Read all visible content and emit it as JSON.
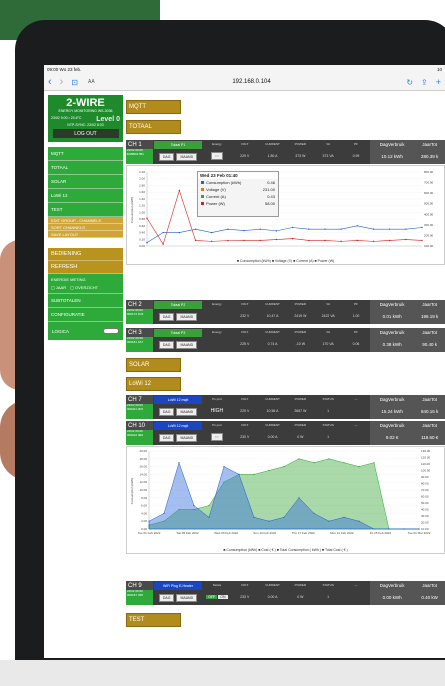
{
  "status": {
    "time": "09:00",
    "date": "Wo 23 feb.",
    "battery": "10"
  },
  "browser": {
    "text_size": "AA",
    "url": "192.168.0.104"
  },
  "brand": {
    "title": "2-WIRE",
    "subtitle": "ENERGY MONITORING WS-3036",
    "datetime": "23/02 9:00 • 23.6°C",
    "level": "Level 0",
    "ntp": "NTP-SYNC: 23/02 8:03",
    "logout": "LOG OUT"
  },
  "menu": {
    "items": [
      "MQTT",
      "TOTAAL",
      "SOLAR",
      "LoWi 12",
      "TEST"
    ],
    "edit_items": [
      "EDIT GROUP - CHANNELS",
      "SORT CHANNELS",
      "SAVE LAYOUT"
    ],
    "bediening": "BEDIENING",
    "refresh": "REFRESH",
    "energie_title": "ENERGIE METING",
    "jaar": "JAAR",
    "overzicht": "OVERZICHT",
    "subtotalen": "SUBTOTALEN",
    "configuratie": "CONFIGURATIE",
    "logica": "LOGICA"
  },
  "tiles": {
    "mqtt": "MQTT",
    "totaal": "TOTAAL",
    "solar": "SOLAR",
    "lowi": "LoWi 12",
    "test": "TEST"
  },
  "columns": {
    "energy": "Energy",
    "pi_port": "P1 port",
    "relais": "Relais",
    "volt": "VOLT",
    "current": "CURRENT",
    "power": "POWER",
    "va": "VA",
    "pf": "PF",
    "status": "STATUS",
    "dash": "---",
    "dag": "DagVerbruik",
    "jaar": "JaarTot"
  },
  "buttons": {
    "dag": "DAG",
    "maand": "MAAND"
  },
  "ch1": {
    "name": "CH 1",
    "time": "23/02 09:00 ESBB017B4",
    "title": "Totaal P1",
    "vals": [
      "229 V",
      "1.80 A",
      "373 W",
      "373 VA",
      "0.99"
    ],
    "dag": "10.12 kWh",
    "jaar": "280.39 k"
  },
  "ch2": {
    "name": "CH 2",
    "time": "23/02 09:00 000172 1D3",
    "title": "Totaal P2",
    "vals": [
      "232 V",
      "10.47 A",
      "2419 W",
      "2422 VA",
      "1.00"
    ],
    "dag": "0.01 kWh",
    "jaar": "198.19 k"
  },
  "ch3": {
    "name": "CH 3",
    "time": "23/02 09:00 000181 FA7",
    "title": "Totaal P3",
    "vals": [
      "225 V",
      "0.74 A",
      "-10 W",
      "170 VA",
      "0.06"
    ],
    "dag": "0.38 kWh",
    "jaar": "90.40 k"
  },
  "ch7": {
    "name": "CH 7",
    "time": "23/02 09:00 000201 3F6",
    "title": "LoWi 12 mqtt",
    "pi": "HIGH",
    "vals": [
      "229 V",
      "10.56 A",
      "2667 W",
      "1"
    ],
    "dag": "15.24 kWh",
    "jaar": "840.16 k"
  },
  "ch10": {
    "name": "CH 10",
    "time": "23/02 09:00 000222 3E0",
    "title": "LoWi 12 mqtt",
    "vals": [
      "230 V",
      "0.00 A",
      "0 W",
      "1"
    ],
    "dag": "9.02 €",
    "jaar": "118.60 €"
  },
  "ch9": {
    "name": "CH 9",
    "time": "23/02 09:00 000187 458",
    "title": "WiFi Plug E-Heater",
    "relais": "OFF",
    "relais2": "ON",
    "vals": [
      "233 V",
      "0.00 A",
      "0 W",
      "1"
    ],
    "dag": "0.00 kWh",
    "jaar": "0.40 kW"
  },
  "chart1": {
    "tooltip": {
      "date": "Wed 23 Feb 01:40",
      "rows": [
        {
          "label": "Consumption (kWh)",
          "value": "0.46",
          "color": "#1f5fd0"
        },
        {
          "label": "Voltage (V)",
          "value": "231.00",
          "color": "#e07b1a"
        },
        {
          "label": "Current (A)",
          "value": "0.43",
          "color": "#2ea82e"
        },
        {
          "label": "Power (W)",
          "value": "58.00",
          "color": "#d02424"
        }
      ]
    },
    "legend": "■ Consumption (kWh)  ■ Voltage (V)  ■ Current (A)  ■ Power (W)"
  },
  "chart2": {
    "legend": "■ Consumption (kWh)  ■ Cost ( € )  ■ Total Consumption ( kWh )  ■ Total Cost ( € )"
  },
  "chart_data": [
    {
      "type": "line",
      "series": [
        {
          "name": "Consumption (kWh)",
          "values": [
            0.1,
            0.4,
            0.4,
            0.5,
            0.4,
            0.5,
            0.46,
            0.5,
            0.45,
            0.55,
            0.5,
            0.5,
            0.5,
            0.6,
            0.5,
            0.5,
            0.5,
            0.55
          ]
        },
        {
          "name": "Power (W)",
          "values": [
            300,
            20,
            600,
            60,
            50,
            58,
            60,
            60,
            70,
            80,
            60,
            60,
            50,
            60,
            50,
            60,
            70,
            60
          ]
        }
      ],
      "ylabel": "Consumption (kWh)",
      "y_ticks": [
        "2.20",
        "2.00",
        "1.80",
        "1.60",
        "1.40",
        "1.20",
        "1.00",
        "0.80",
        "0.60",
        "0.40",
        "0.20",
        "0.00"
      ],
      "y2_ticks": [
        "800.00",
        "700.00",
        "600.00",
        "500.00",
        "400.00",
        "300.00",
        "200.00",
        "100.00"
      ],
      "ylim": [
        0,
        2.2
      ]
    },
    {
      "type": "area",
      "series": [
        {
          "name": "Consumption (kWh)",
          "values": [
            2,
            4,
            17,
            6,
            3,
            16,
            14,
            3,
            2,
            3,
            8,
            4,
            2,
            3,
            2,
            0,
            0,
            0,
            0
          ]
        },
        {
          "name": "Total Consumption ( kWh )",
          "values": [
            1,
            2,
            5,
            5,
            6,
            12,
            14,
            14,
            15,
            16,
            18,
            17,
            18,
            17,
            16,
            17,
            0,
            0,
            0
          ]
        }
      ],
      "x_ticks": [
        "Tue 01 Feb 2022",
        "Sat 05 Feb 2022",
        "Wed 09 Feb 2022",
        "Sun 13 Feb 2022",
        "Thu 17 Feb 2022",
        "Mon 21 Feb 2022",
        "Fri 25 Feb 2022",
        "Tue 01 Mar 2022"
      ],
      "y_ticks": [
        "20.00",
        "18.00",
        "16.00",
        "14.00",
        "12.00",
        "10.00",
        "8.00",
        "6.00",
        "4.00",
        "2.00",
        "0.00"
      ],
      "y2_ticks": [
        "130.00",
        "120.00",
        "110.00",
        "100.00",
        "90.00",
        "80.00",
        "70.00",
        "60.00",
        "50.00",
        "40.00",
        "30.00",
        "20.00",
        "10.00"
      ],
      "ylabel": "Consumption (kWh)",
      "ylim": [
        0,
        20
      ]
    }
  ]
}
